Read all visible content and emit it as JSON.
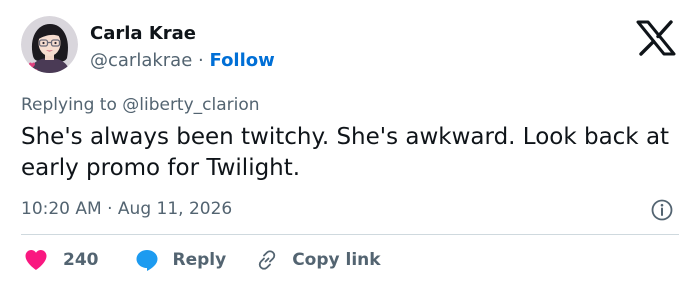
{
  "user": {
    "name": "Carla Krae",
    "handle": "@carlakrae",
    "separator": "·",
    "follow_label": "Follow"
  },
  "tweet": {
    "replying_prefix": "Replying to",
    "replying_to": "@liberty_clarion",
    "text": "She's always been twitchy. She's awkward. Look back at early promo for Twilight.",
    "time": "10:20 AM",
    "date_separator": "·",
    "date": "Aug 11, 2026"
  },
  "actions": {
    "like_count": "240",
    "reply_label": "Reply",
    "copy_label": "Copy link"
  },
  "icons": {
    "logo": "x-logo-icon",
    "info": "info-icon",
    "like": "heart-icon",
    "reply": "speech-bubble-icon",
    "copy": "link-icon"
  },
  "colors": {
    "follow": "#006fd6",
    "like": "#f91880",
    "reply": "#1d9bf0",
    "muted": "#536471",
    "text": "#0f1419",
    "divider": "#cfd9de"
  }
}
